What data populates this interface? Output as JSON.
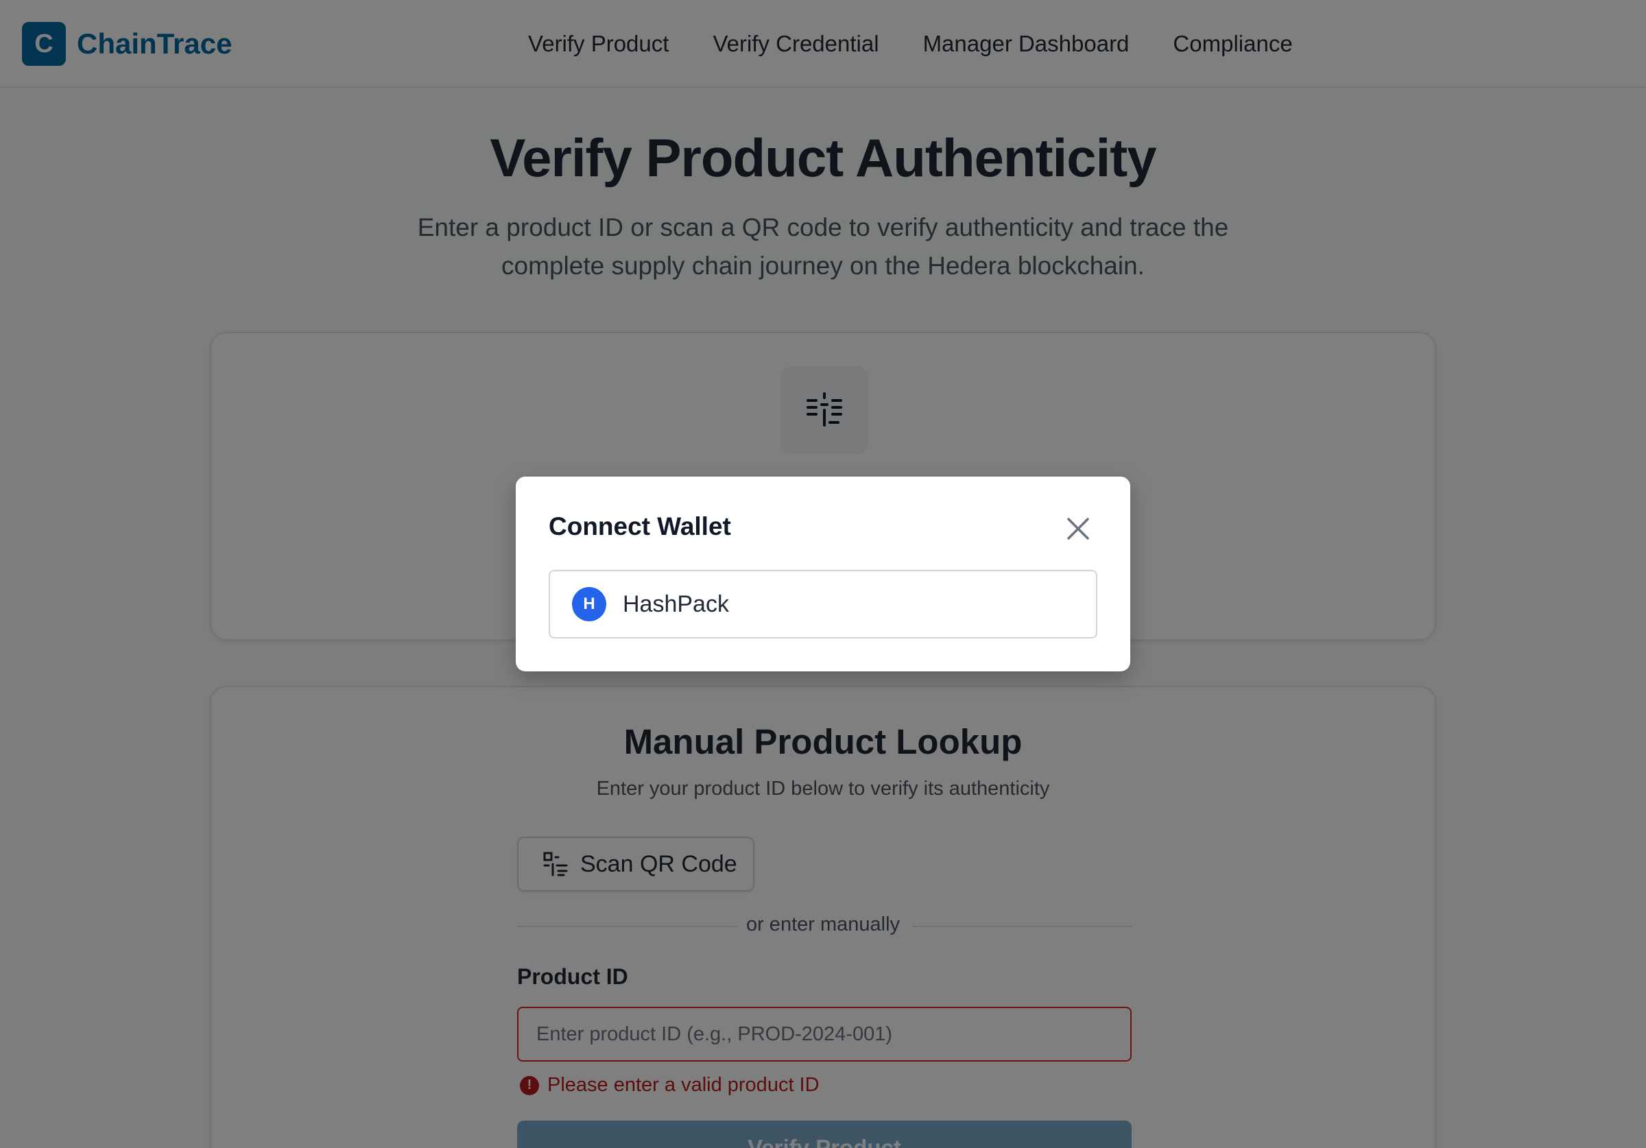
{
  "header": {
    "logo_letter": "C",
    "brand": "ChainTrace",
    "nav": [
      "Verify Product",
      "Verify Credential",
      "Manager Dashboard",
      "Compliance"
    ]
  },
  "hero": {
    "title": "Verify Product Authenticity",
    "subtitle": "Enter a product ID or scan a QR code to verify authenticity and trace the complete supply chain journey on the Hedera blockchain."
  },
  "scan_card": {
    "icon": "qr-scan-icon"
  },
  "manual_lookup": {
    "title": "Manual Product Lookup",
    "subtitle": "Enter your product ID below to verify its authenticity",
    "scan_button_label": "Scan QR Code",
    "divider_text": "or enter manually",
    "field_label": "Product ID",
    "input_value": "",
    "input_placeholder": "Enter product ID (e.g., PROD-2024-001)",
    "error_icon": "!",
    "error_text": "Please enter a valid product ID",
    "verify_button_label": "Verify Product"
  },
  "modal": {
    "title": "Connect Wallet",
    "close_icon": "close-icon",
    "wallets": [
      {
        "icon_letter": "H",
        "name": "HashPack"
      }
    ]
  },
  "colors": {
    "brand": "#0369a1",
    "error": "#dc2626",
    "wallet_accent": "#2563eb",
    "overlay": "rgba(0,0,0,0.5)"
  }
}
